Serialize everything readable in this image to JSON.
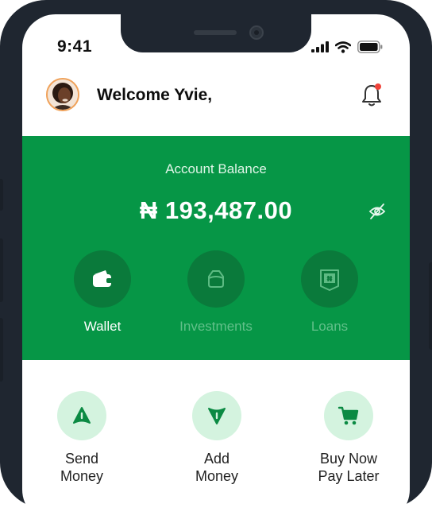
{
  "status_bar": {
    "time": "9:41"
  },
  "header": {
    "welcome": "Welcome Yvie,"
  },
  "balance": {
    "label": "Account Balance",
    "amount": "₦ 193,487.00"
  },
  "account_tabs": [
    {
      "label": "Wallet",
      "active": true
    },
    {
      "label": "Investments",
      "active": false
    },
    {
      "label": "Loans",
      "active": false
    }
  ],
  "quick_actions": [
    {
      "line1": "Send",
      "line2": "Money",
      "icon": "send-icon"
    },
    {
      "line1": "Add",
      "line2": "Money",
      "icon": "add-money-icon"
    },
    {
      "line1": "Buy Now",
      "line2": "Pay Later",
      "icon": "cart-icon"
    }
  ],
  "colors": {
    "primary": "#069646",
    "action_bg": "#d4f3df",
    "notification_dot": "#f0433a"
  }
}
